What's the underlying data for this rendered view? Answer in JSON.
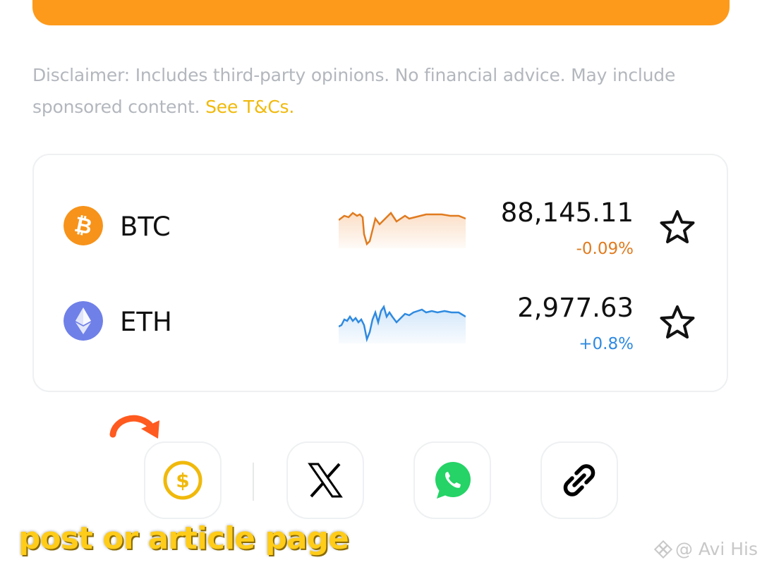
{
  "disclaimer": {
    "text": "Disclaimer: Includes third-party opinions. No financial advice. May include sponsored content.",
    "link": "See T&Cs."
  },
  "coins": [
    {
      "symbol": "BTC",
      "price": "88,145.11",
      "change": "-0.09%",
      "change_color": "#e07b1f",
      "icon": "bitcoin-icon",
      "icon_color": "#f7931a"
    },
    {
      "symbol": "ETH",
      "price": "2,977.63",
      "change": "+0.8%",
      "change_color": "#2f8ae0",
      "icon": "ethereum-icon",
      "icon_color": "#6f80e8"
    }
  ],
  "share": [
    "tip-icon",
    "x-icon",
    "whatsapp-icon",
    "link-icon"
  ],
  "overlay_caption": "post or article page",
  "watermark": "@ Avi His",
  "colors": {
    "accent": "#fd9a1b",
    "link": "#f0b90b"
  }
}
